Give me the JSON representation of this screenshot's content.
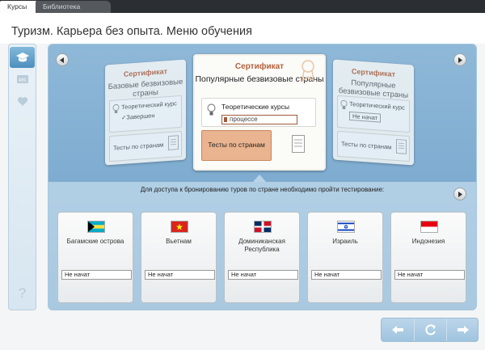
{
  "tabs": {
    "courses": "Курсы",
    "library": "Библиотека"
  },
  "header": {
    "title": "Туризм. Карьера без опыта. Меню обучения"
  },
  "rail": {
    "help": "?"
  },
  "certs": {
    "left": {
      "title": "Сертификат",
      "name": "Базовые безвизовые страны",
      "course": "Теоретический курс",
      "course_status": "Завершен",
      "tests": "Тесты по странам"
    },
    "center": {
      "title": "Сертификат",
      "name": "Популярные безвизовые страны",
      "course": "Теоретические курсы",
      "course_status": "процессе",
      "tests": "Тесты по странам"
    },
    "right": {
      "title": "Сертификат",
      "name": "Популярные безвизовые страны",
      "course": "Теоретический курс",
      "course_status": "Не начат",
      "tests": "Тесты по странам"
    }
  },
  "notice": "Для доступа к бронированию туров по стране необходимо пройти тестирование:",
  "countries": [
    {
      "name": "Багамские острова",
      "status": "Не начат"
    },
    {
      "name": "Вьетнам",
      "status": "Не начат"
    },
    {
      "name": "Доминиканская Республика",
      "status": "Не начат"
    },
    {
      "name": "Израиль",
      "status": "Не начат"
    },
    {
      "name": "Индонезия",
      "status": "Не начат"
    }
  ],
  "colors": {
    "accent_orange": "#e9b48f",
    "stage_blue": "#8fb8d8",
    "nav_blue": "#a9cbe3",
    "brown": "#9c5b3a"
  }
}
